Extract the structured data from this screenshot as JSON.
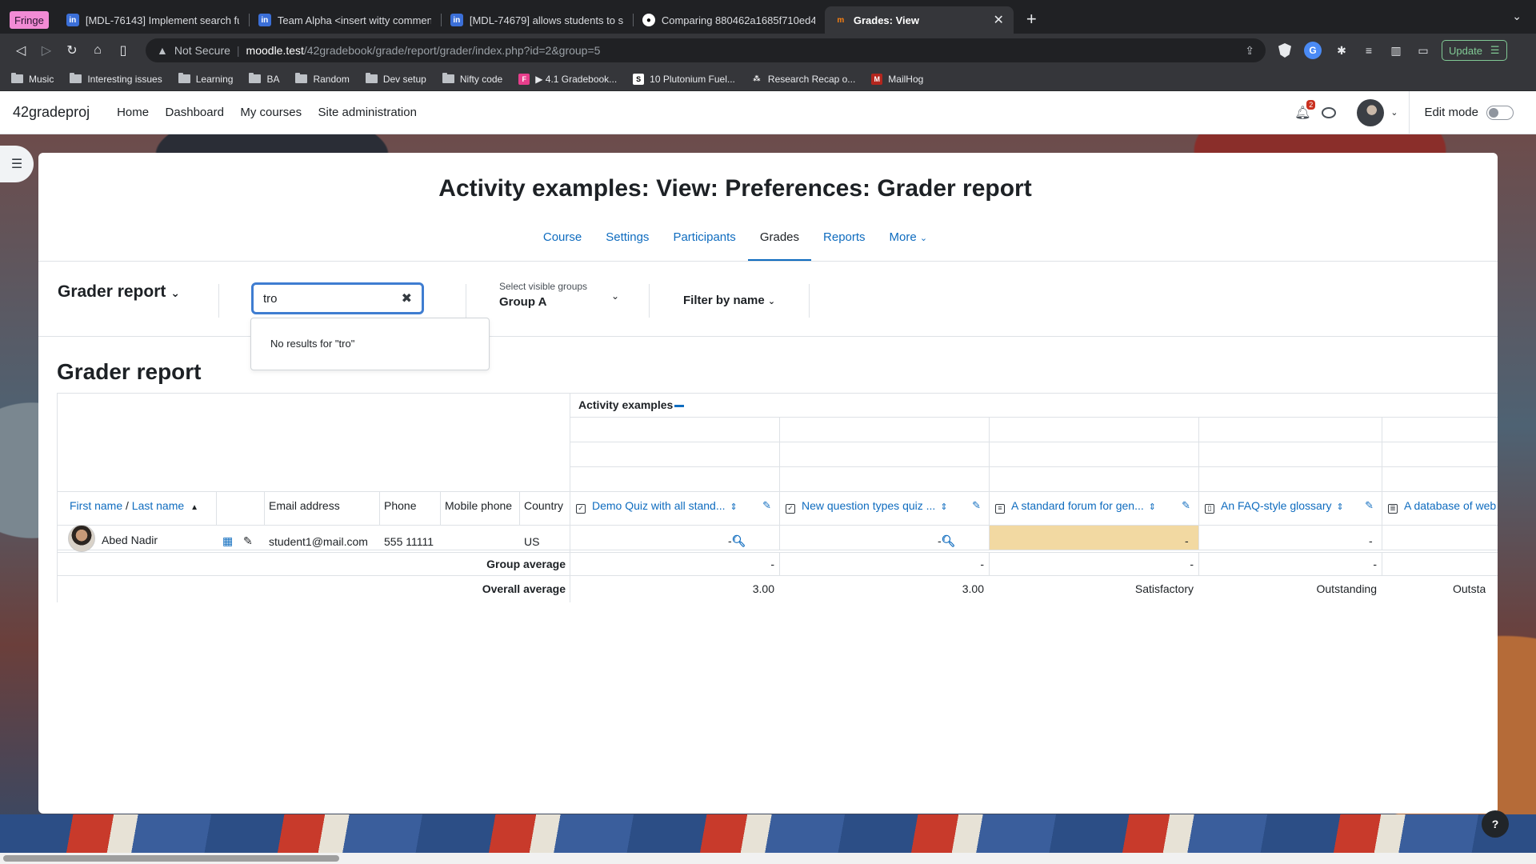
{
  "browser": {
    "fringe_label": "Fringe",
    "tabs": [
      {
        "label": "[MDL-76143] Implement search fun",
        "icon": "jira-icon"
      },
      {
        "label": "Team Alpha <insert witty comment",
        "icon": "jira-icon"
      },
      {
        "label": "[MDL-74679] allows students to se",
        "icon": "jira-icon"
      },
      {
        "label": "Comparing 880462a1685f710ed4f6",
        "icon": "github-icon"
      },
      {
        "label": "Grades: View",
        "icon": "moodle-icon"
      }
    ],
    "url_warning": "Not Secure",
    "url_host": "moodle.test",
    "url_path": "/42gradebook/grade/report/grader/index.php?id=2&group=5",
    "update_label": "Update",
    "bookmarks": [
      {
        "label": "Music",
        "type": "folder"
      },
      {
        "label": "Interesting issues",
        "type": "folder"
      },
      {
        "label": "Learning",
        "type": "folder"
      },
      {
        "label": "BA",
        "type": "folder"
      },
      {
        "label": "Random",
        "type": "folder"
      },
      {
        "label": "Dev setup",
        "type": "folder"
      },
      {
        "label": "Nifty code",
        "type": "folder"
      },
      {
        "label": "▶ 4.1 Gradebook...",
        "type": "site"
      },
      {
        "label": "10 Plutonium Fuel...",
        "type": "site"
      },
      {
        "label": "Research Recap o...",
        "type": "site"
      },
      {
        "label": "MailHog",
        "type": "site"
      }
    ]
  },
  "navbar": {
    "brand": "42gradeproj",
    "links": [
      "Home",
      "Dashboard",
      "My courses",
      "Site administration"
    ],
    "notification_count": "2",
    "edit_mode_label": "Edit mode"
  },
  "page": {
    "title": "Activity examples: View: Preferences: Grader report",
    "tabs": [
      "Course",
      "Settings",
      "Participants",
      "Grades",
      "Reports",
      "More"
    ],
    "active_tab": "Grades",
    "report_selector": "Grader report",
    "search_value": "tro",
    "search_dropdown": "No results for \"tro\"",
    "groups_label": "Select visible groups",
    "groups_value": "Group A",
    "filter_by_name": "Filter by name",
    "heading": "Grader report"
  },
  "grader": {
    "category": "Activity examples",
    "columns": {
      "name_first": "First name",
      "name_slash": " / ",
      "name_last": "Last name",
      "email": "Email address",
      "phone": "Phone",
      "mobile": "Mobile phone",
      "country": "Country",
      "items": [
        {
          "label": "Demo Quiz with all stand...",
          "icon": "quiz-icon"
        },
        {
          "label": "New question types quiz ...",
          "icon": "quiz-icon"
        },
        {
          "label": "A standard forum for gen...",
          "icon": "forum-icon"
        },
        {
          "label": "An FAQ-style glossary",
          "icon": "glossary-icon"
        },
        {
          "label": "A database of web links",
          "icon": "database-icon"
        }
      ]
    },
    "student": {
      "name": "Abed Nadir",
      "email": "student1@mail.com",
      "phone": "555 11111",
      "mobile": "",
      "country": "US",
      "grades": [
        "-",
        "-",
        "-",
        "-",
        ""
      ]
    },
    "group_average_label": "Group average",
    "group_average": [
      "-",
      "-",
      "-",
      "-",
      ""
    ],
    "overall_average_label": "Overall average",
    "overall_average": [
      "3.00",
      "3.00",
      "Satisfactory",
      "Outstanding",
      "Outsta"
    ]
  },
  "help_label": "?"
}
